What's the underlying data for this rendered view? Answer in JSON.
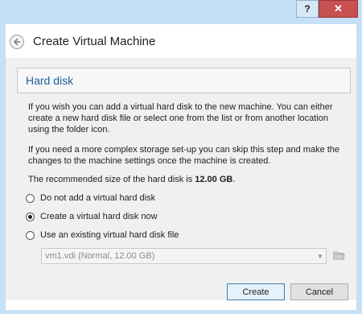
{
  "titlebar": {
    "help_label": "?",
    "close_label": "✕"
  },
  "dialog": {
    "title": "Create Virtual Machine"
  },
  "page": {
    "heading": "Hard disk",
    "para1": "If you wish you can add a virtual hard disk to the new machine. You can either create a new hard disk file or select one from the list or from another location using the folder icon.",
    "para2": "If you need a more complex storage set-up you can skip this step and make the changes to the machine settings once the machine is created.",
    "para3_prefix": "The recommended size of the hard disk is ",
    "para3_value": "12.00 GB",
    "para3_suffix": "."
  },
  "options": [
    {
      "label": "Do not add a virtual hard disk",
      "checked": false
    },
    {
      "label": "Create a virtual hard disk now",
      "checked": true
    },
    {
      "label": "Use an existing virtual hard disk file",
      "checked": false
    }
  ],
  "disk_select": {
    "value": "vm1.vdi (Normal, 12.00 GB)",
    "enabled": false
  },
  "buttons": {
    "create": "Create",
    "cancel": "Cancel"
  },
  "icons": {
    "back": "back-arrow-icon",
    "folder": "folder-icon",
    "dropdown": "chevron-down-icon"
  }
}
